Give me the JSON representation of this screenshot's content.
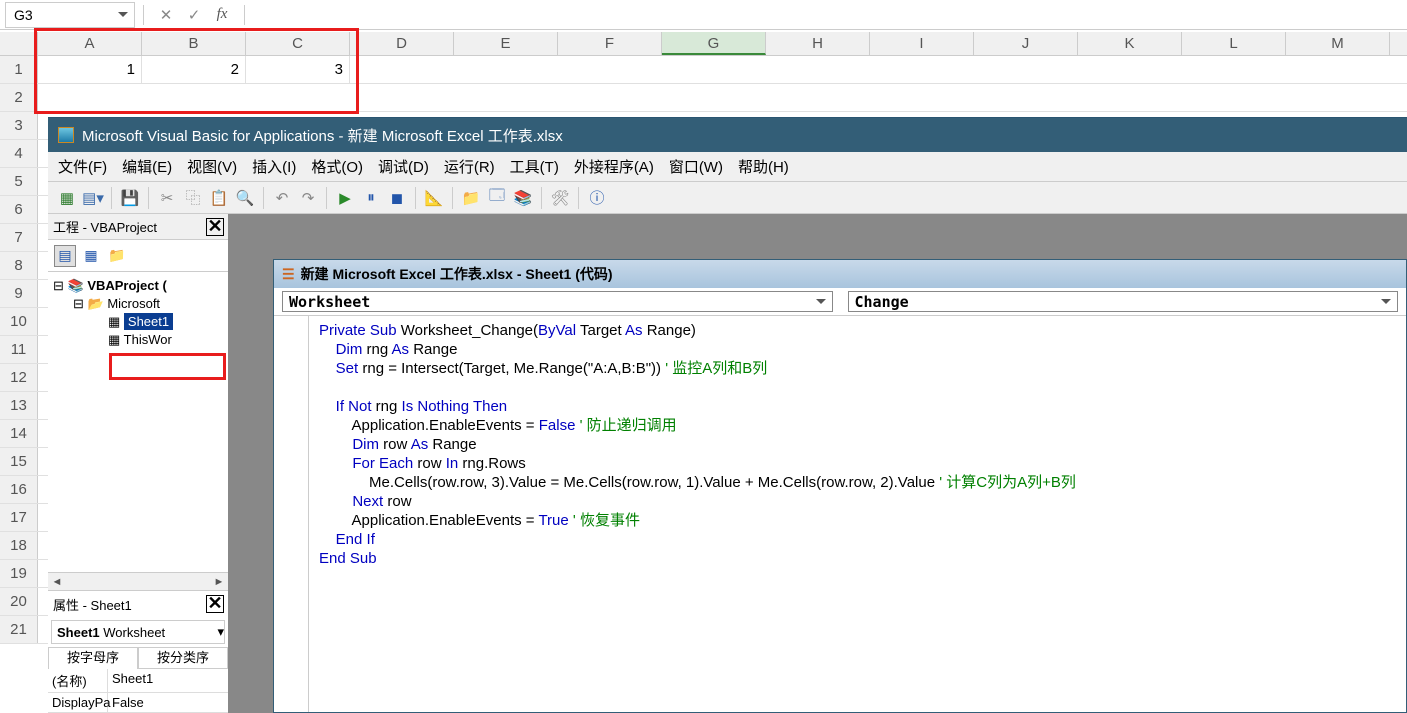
{
  "namebox": "G3",
  "fx": "fx",
  "columns": [
    "A",
    "B",
    "C",
    "D",
    "E",
    "F",
    "G",
    "H",
    "I",
    "J",
    "K",
    "L",
    "M"
  ],
  "active_col": "G",
  "rows": [
    "1",
    "2",
    "3",
    "4",
    "5",
    "6",
    "7",
    "8",
    "9",
    "10",
    "11",
    "12",
    "13",
    "14",
    "15",
    "16",
    "17",
    "18",
    "19",
    "20",
    "21"
  ],
  "cells": {
    "A1": "1",
    "B1": "2",
    "C1": "3"
  },
  "vbe": {
    "title": "Microsoft Visual Basic for Applications - 新建 Microsoft Excel 工作表.xlsx",
    "menu": {
      "file": "文件(F)",
      "edit": "编辑(E)",
      "view": "视图(V)",
      "insert": "插入(I)",
      "format": "格式(O)",
      "debug": "调试(D)",
      "run": "运行(R)",
      "tools": "工具(T)",
      "addins": "外接程序(A)",
      "window": "窗口(W)",
      "help": "帮助(H)"
    },
    "proj_title": "工程 - VBAProject",
    "tree": {
      "root": "VBAProject (",
      "folder": "Microsoft",
      "sheet1": "Sheet1",
      "thiswb": "ThisWor"
    },
    "props_title": "属性 - Sheet1",
    "props_combo": "Sheet1 Worksheet",
    "tabs": {
      "alpha": "按字母序",
      "cat": "按分类序"
    },
    "props": {
      "name_label": "(名称)",
      "name_val": "Sheet1",
      "dp_label": "DisplayPa",
      "dp_val": "False"
    },
    "code_title": "新建 Microsoft Excel 工作表.xlsx - Sheet1 (代码)",
    "combo_obj": "Worksheet",
    "combo_proc": "Change"
  },
  "code": {
    "l1a": "Private Sub",
    "l1b": " Worksheet_Change(",
    "l1c": "ByVal",
    "l1d": " Target ",
    "l1e": "As",
    "l1f": " Range)",
    "l2a": "    Dim",
    "l2b": " rng ",
    "l2c": "As",
    "l2d": " Range",
    "l3a": "    Set",
    "l3b": " rng = Intersect(Target, Me.Range(\"A:A,B:B\")) ",
    "l3c": "' 监控A列和B列",
    "l4": "    ",
    "l5a": "    If Not",
    "l5b": " rng ",
    "l5c": "Is Nothing Then",
    "l6a": "        Application.EnableEvents = ",
    "l6b": "False ",
    "l6c": "' 防止递归调用",
    "l7a": "        Dim",
    "l7b": " row ",
    "l7c": "As",
    "l7d": " Range",
    "l8a": "        For Each",
    "l8b": " row ",
    "l8c": "In",
    "l8d": " rng.Rows",
    "l9": "            Me.Cells(row.row, 3).Value = Me.Cells(row.row, 1).Value + Me.Cells(row.row, 2).Value ",
    "l9c": "' 计算C列为A列+B列",
    "l10a": "        Next",
    "l10b": " row",
    "l11a": "        Application.EnableEvents = ",
    "l11b": "True ",
    "l11c": "' 恢复事件",
    "l12": "    End If",
    "l13": "End Sub"
  }
}
